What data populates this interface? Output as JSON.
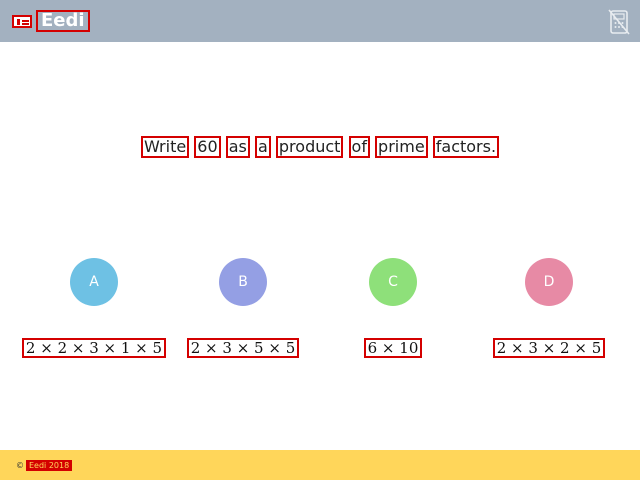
{
  "header": {
    "logo_text": "Eedi",
    "calculator_icon": "calculator-disabled-icon",
    "colors": {
      "bar": "#a3b1c0"
    }
  },
  "question": {
    "words": [
      "Write",
      "60",
      "as",
      "a",
      "product",
      "of",
      "prime",
      "factors."
    ]
  },
  "options": [
    {
      "letter": "A",
      "answer": "2 × 2 × 3 × 1 × 5",
      "color": "#6ec1e4"
    },
    {
      "letter": "B",
      "answer": "2 × 3 × 5 × 5",
      "color": "#949fe4"
    },
    {
      "letter": "C",
      "answer": "6 × 10",
      "color": "#8ee07a"
    },
    {
      "letter": "D",
      "answer": "2 × 3 × 2 × 5",
      "color": "#e78aa5"
    }
  ],
  "footer": {
    "copyright_symbol": "©",
    "copyright_text": "Eedi 2018",
    "colors": {
      "bar": "#ffd65a"
    }
  }
}
